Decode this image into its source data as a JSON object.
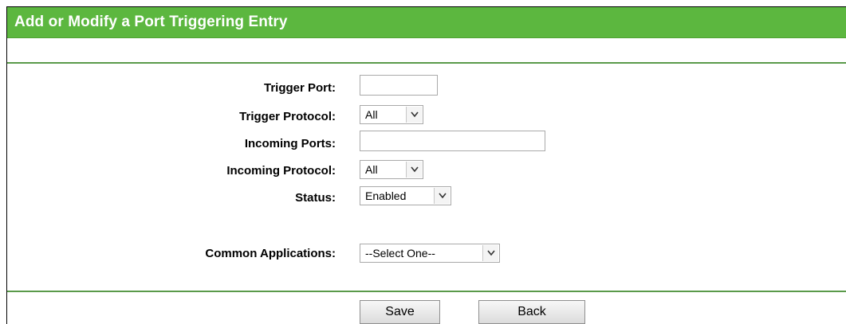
{
  "header": {
    "title": "Add or Modify a Port Triggering Entry"
  },
  "form": {
    "trigger_port_label": "Trigger Port:",
    "trigger_port_value": "",
    "trigger_protocol_label": "Trigger Protocol:",
    "trigger_protocol_value": "All",
    "incoming_ports_label": "Incoming Ports:",
    "incoming_ports_value": "",
    "incoming_protocol_label": "Incoming Protocol:",
    "incoming_protocol_value": "All",
    "status_label": "Status:",
    "status_value": "Enabled",
    "common_applications_label": "Common Applications:",
    "common_applications_value": "--Select One--"
  },
  "buttons": {
    "save_label": "Save",
    "back_label": "Back"
  },
  "colors": {
    "header_bg": "#5cb73f",
    "divider": "#5a9a4a"
  },
  "icons": {
    "select_arrow": "chevron-down-icon"
  }
}
